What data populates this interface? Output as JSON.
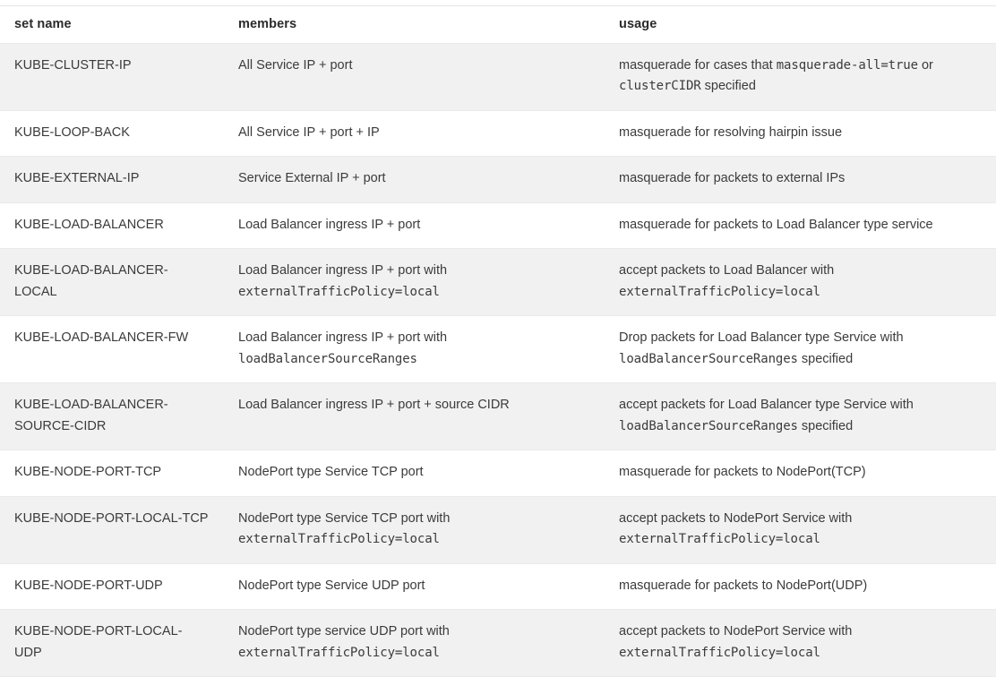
{
  "table": {
    "name": "kube-proxy-ipset-table",
    "columns": [
      {
        "key": "set_name",
        "label": "set name"
      },
      {
        "key": "members",
        "label": "members"
      },
      {
        "key": "usage",
        "label": "usage"
      }
    ],
    "rows": [
      {
        "set_name": "KUBE-CLUSTER-IP",
        "members": [
          {
            "type": "text",
            "value": "All Service IP + port"
          }
        ],
        "usage": [
          {
            "type": "text",
            "value": "masquerade for cases that "
          },
          {
            "type": "code",
            "value": "masquerade-all=true"
          },
          {
            "type": "text",
            "value": " or "
          },
          {
            "type": "code",
            "value": "clusterCIDR"
          },
          {
            "type": "text",
            "value": " specified"
          }
        ]
      },
      {
        "set_name": "KUBE-LOOP-BACK",
        "members": [
          {
            "type": "text",
            "value": "All Service IP + port + IP"
          }
        ],
        "usage": [
          {
            "type": "text",
            "value": "masquerade for resolving hairpin issue"
          }
        ]
      },
      {
        "set_name": "KUBE-EXTERNAL-IP",
        "members": [
          {
            "type": "text",
            "value": "Service External IP + port"
          }
        ],
        "usage": [
          {
            "type": "text",
            "value": "masquerade for packets to external IPs"
          }
        ]
      },
      {
        "set_name": "KUBE-LOAD-BALANCER",
        "members": [
          {
            "type": "text",
            "value": "Load Balancer ingress IP + port"
          }
        ],
        "usage": [
          {
            "type": "text",
            "value": "masquerade for packets to Load Balancer type service"
          }
        ]
      },
      {
        "set_name": "KUBE-LOAD-BALANCER-LOCAL",
        "members": [
          {
            "type": "text",
            "value": "Load Balancer ingress IP + port with "
          },
          {
            "type": "code",
            "value": "externalTrafficPolicy=local"
          }
        ],
        "usage": [
          {
            "type": "text",
            "value": "accept packets to Load Balancer with "
          },
          {
            "type": "code",
            "value": "externalTrafficPolicy=local"
          }
        ]
      },
      {
        "set_name": "KUBE-LOAD-BALANCER-FW",
        "members": [
          {
            "type": "text",
            "value": "Load Balancer ingress IP + port with "
          },
          {
            "type": "code",
            "value": "loadBalancerSourceRanges"
          }
        ],
        "usage": [
          {
            "type": "text",
            "value": "Drop packets for Load Balancer type Service with "
          },
          {
            "type": "code",
            "value": "loadBalancerSourceRanges"
          },
          {
            "type": "text",
            "value": " specified"
          }
        ]
      },
      {
        "set_name": "KUBE-LOAD-BALANCER-SOURCE-CIDR",
        "members": [
          {
            "type": "text",
            "value": "Load Balancer ingress IP + port + source CIDR"
          }
        ],
        "usage": [
          {
            "type": "text",
            "value": "accept packets for Load Balancer type Service with "
          },
          {
            "type": "code",
            "value": "loadBalancerSourceRanges"
          },
          {
            "type": "text",
            "value": " specified"
          }
        ]
      },
      {
        "set_name": "KUBE-NODE-PORT-TCP",
        "members": [
          {
            "type": "text",
            "value": "NodePort type Service TCP port"
          }
        ],
        "usage": [
          {
            "type": "text",
            "value": "masquerade for packets to NodePort(TCP)"
          }
        ]
      },
      {
        "set_name": "KUBE-NODE-PORT-LOCAL-TCP",
        "members": [
          {
            "type": "text",
            "value": "NodePort type Service TCP port with "
          },
          {
            "type": "code",
            "value": "externalTrafficPolicy=local"
          }
        ],
        "usage": [
          {
            "type": "text",
            "value": "accept packets to NodePort Service with "
          },
          {
            "type": "code",
            "value": "externalTrafficPolicy=local"
          }
        ]
      },
      {
        "set_name": "KUBE-NODE-PORT-UDP",
        "members": [
          {
            "type": "text",
            "value": "NodePort type Service UDP port"
          }
        ],
        "usage": [
          {
            "type": "text",
            "value": "masquerade for packets to NodePort(UDP)"
          }
        ]
      },
      {
        "set_name": "KUBE-NODE-PORT-LOCAL-UDP",
        "members": [
          {
            "type": "text",
            "value": "NodePort type service UDP port with "
          },
          {
            "type": "code",
            "value": "externalTrafficPolicy=local"
          }
        ],
        "usage": [
          {
            "type": "text",
            "value": "accept packets to NodePort Service with "
          },
          {
            "type": "code",
            "value": "externalTrafficPolicy=local"
          }
        ]
      }
    ]
  },
  "colors": {
    "text": "#3b3b3b",
    "header_text": "#2b2b2b",
    "row_stripe": "#f1f1f1",
    "row_plain": "#ffffff",
    "border": "#eaeaea",
    "page_background": "#ffffff"
  }
}
